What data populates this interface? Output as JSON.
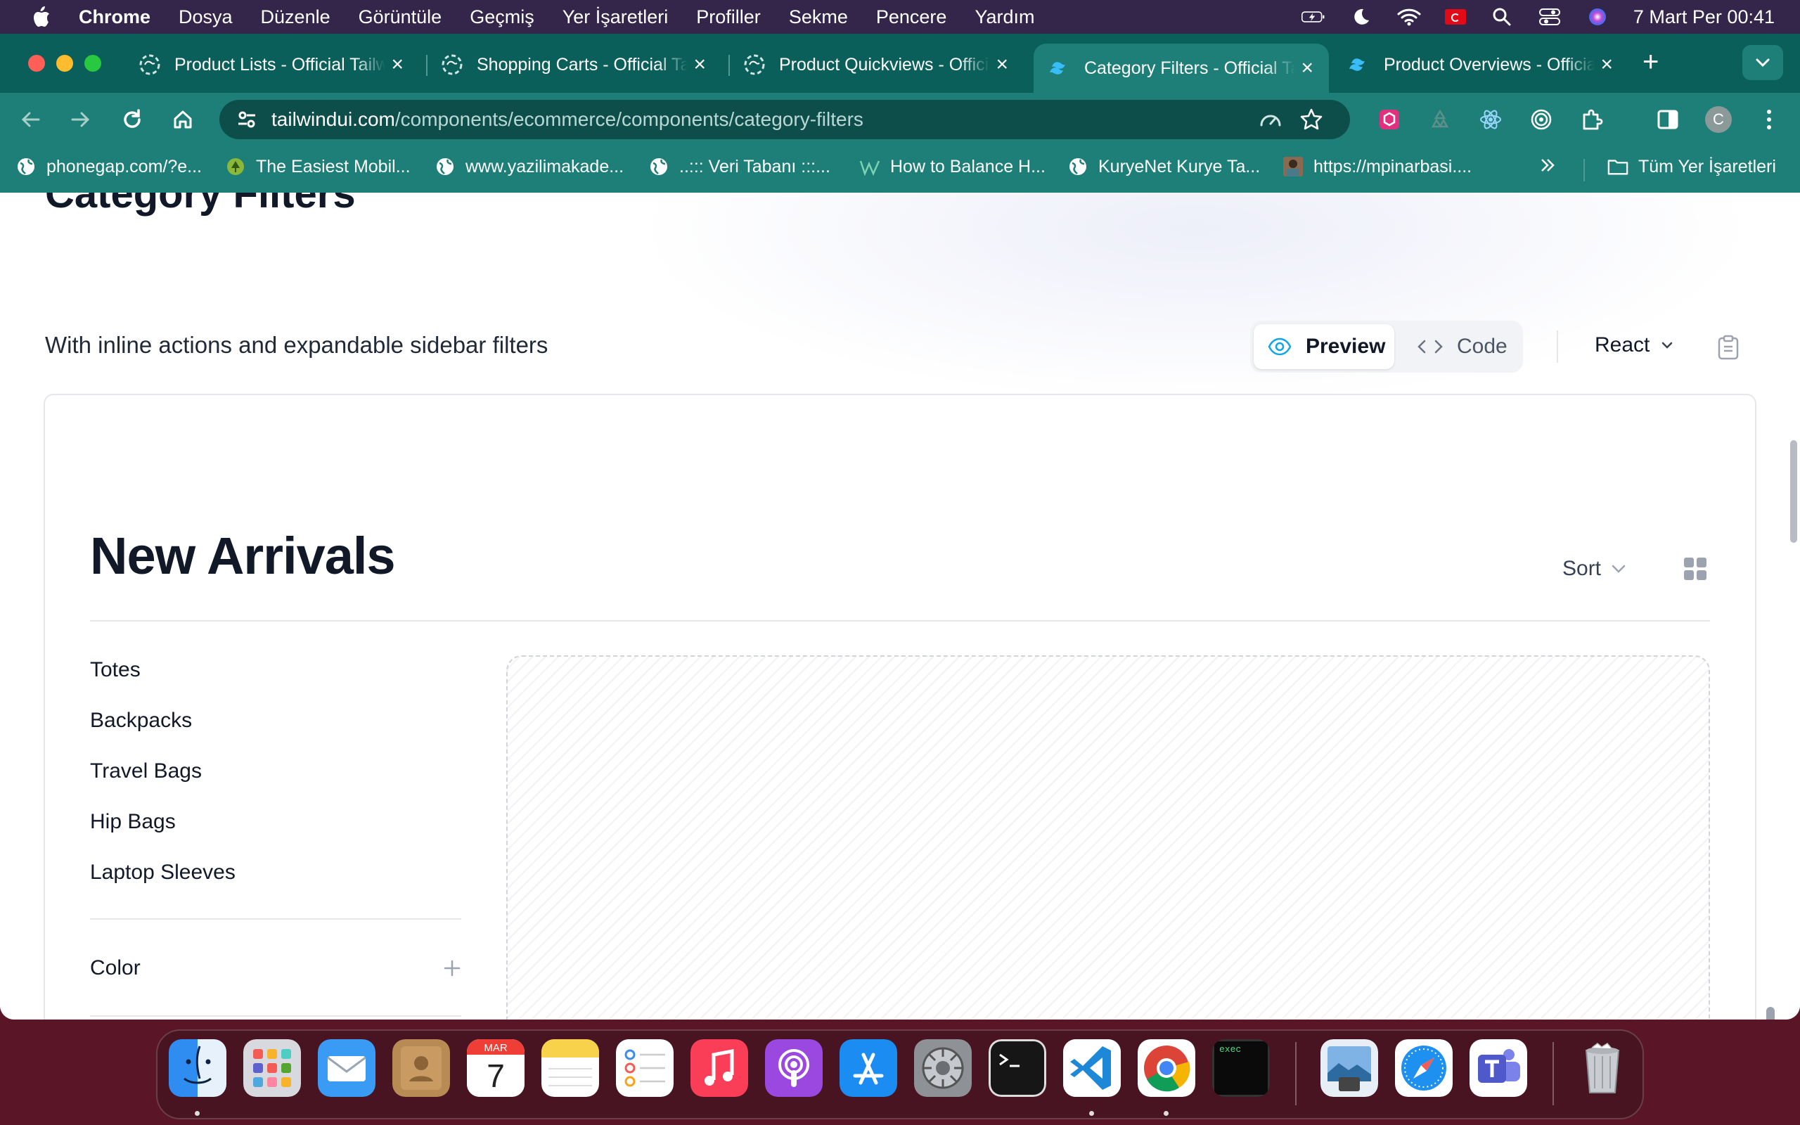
{
  "menubar": {
    "app": "Chrome",
    "items": [
      "Dosya",
      "Düzenle",
      "Görüntüle",
      "Geçmiş",
      "Yer İşaretleri",
      "Profiller",
      "Sekme",
      "Pencere",
      "Yardım"
    ],
    "clock": "7 Mart Per  00:41"
  },
  "tabs": [
    {
      "title": "Product Lists - Official Tailwind UI",
      "active": false,
      "icon": "tailwind-loading-icon"
    },
    {
      "title": "Shopping Carts - Official Tailwind UI",
      "active": false,
      "icon": "tailwind-loading-icon"
    },
    {
      "title": "Product Quickviews - Official Tailwind UI",
      "active": false,
      "icon": "tailwind-loading-icon"
    },
    {
      "title": "Category Filters - Official Tailwind UI",
      "active": true,
      "icon": "tailwind-icon"
    },
    {
      "title": "Product Overviews - Official Tailwind UI",
      "active": false,
      "icon": "tailwind-icon"
    }
  ],
  "omnibox": {
    "host": "tailwindui.com",
    "path": "/components/ecommerce/components/category-filters"
  },
  "profile_initial": "C",
  "bookmarks": [
    {
      "label": "phonegap.com/?e...",
      "icon": "globe-icon"
    },
    {
      "label": "The Easiest Mobil...",
      "icon": "tree-icon"
    },
    {
      "label": "www.yazilimakade...",
      "icon": "globe-icon"
    },
    {
      "label": "..::: Veri Tabanı :::...",
      "icon": "globe-icon"
    },
    {
      "label": "How to Balance H...",
      "icon": "w-logo-icon"
    },
    {
      "label": "KuryeNet Kurye Ta...",
      "icon": "globe-icon"
    },
    {
      "label": "https://mpinarbasi....",
      "icon": "photo-icon"
    }
  ],
  "all_bookmarks": "Tüm Yer İşaretleri",
  "page": {
    "heading": "Category Filters",
    "subtitle": "With inline actions and expandable sidebar filters",
    "preview_label": "Preview",
    "code_label": "Code",
    "framework": "React"
  },
  "preview": {
    "title": "New Arrivals",
    "sort_label": "Sort",
    "categories": [
      "Totes",
      "Backpacks",
      "Travel Bags",
      "Hip Bags",
      "Laptop Sleeves"
    ],
    "filter_section": "Color"
  },
  "dock": {
    "apps": [
      "finder",
      "launchpad",
      "mail",
      "contacts",
      "calendar",
      "notes",
      "reminders",
      "music",
      "podcasts",
      "app-store",
      "system-settings",
      "terminal",
      "vscode",
      "chrome",
      "exec-terminal",
      "preview",
      "safari",
      "teams",
      "trash"
    ],
    "calendar_month": "MAR",
    "calendar_day": "7",
    "exec_label": "exec"
  },
  "colors": {
    "tab_strip": "#0b5f5a",
    "toolbar": "#1d7f78",
    "accent_preview": "#0ea5e9",
    "heading": "#111827"
  }
}
